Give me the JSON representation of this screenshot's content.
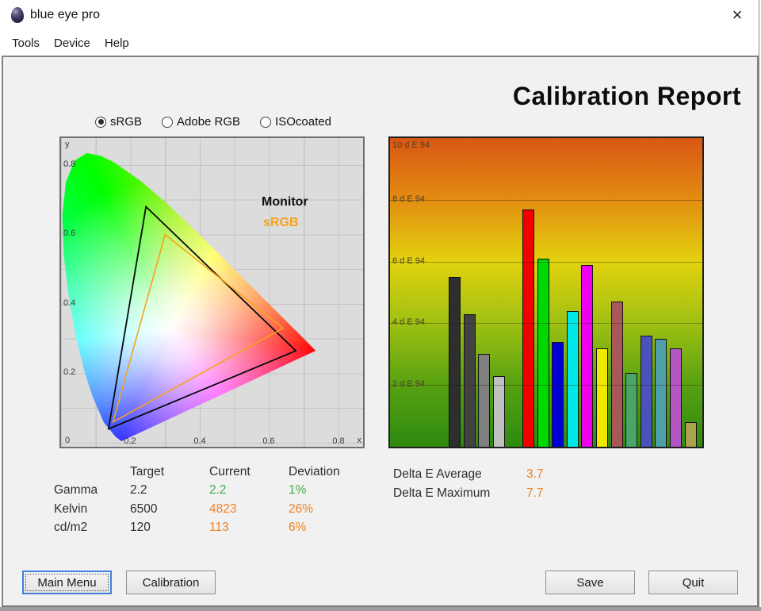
{
  "window": {
    "title": "blue eye pro",
    "close_glyph": "×"
  },
  "menu": {
    "items": [
      "Tools",
      "Device",
      "Help"
    ]
  },
  "report_title": "Calibration Report",
  "gamut_selector": {
    "options": [
      {
        "label": "sRGB",
        "selected": true
      },
      {
        "label": "Adobe RGB",
        "selected": false
      },
      {
        "label": "ISOcoated",
        "selected": false
      }
    ]
  },
  "cie_chart": {
    "y_axis_label": "y",
    "x_axis_label": "x",
    "origin_label": "0",
    "y_ticks": [
      "0.8",
      "0.6",
      "0.4",
      "0.2"
    ],
    "x_ticks": [
      "0.2",
      "0.4",
      "0.6",
      "0.8"
    ],
    "legend": {
      "monitor": "Monitor",
      "reference": "sRGB",
      "reference_color": "#f5a21c"
    },
    "monitor_gamut": {
      "red": [
        0.677,
        0.265
      ],
      "green": [
        0.245,
        0.68
      ],
      "blue": [
        0.137,
        0.04
      ]
    },
    "srgb_gamut": {
      "red": [
        0.64,
        0.33
      ],
      "green": [
        0.3,
        0.6
      ],
      "blue": [
        0.15,
        0.06
      ]
    },
    "monitor_color": "#0a0a0a"
  },
  "delta_chart": {
    "ymax": 10,
    "axis_labels": [
      "10 d E 94",
      "8 d E 94",
      "6 d E 94",
      "4 d E 94",
      "2 d E 94"
    ],
    "gridline_values": [
      8,
      6,
      4,
      2
    ],
    "groups": [
      {
        "name": "grayscale",
        "bars": [
          {
            "name": "black",
            "value": 5.5,
            "color": "#2e2e2e"
          },
          {
            "name": "dark-gray",
            "value": 4.3,
            "color": "#424242"
          },
          {
            "name": "gray",
            "value": 3.0,
            "color": "#7f7f7f"
          },
          {
            "name": "light-gray",
            "value": 2.3,
            "color": "#c0c0c0"
          }
        ]
      },
      {
        "name": "colors",
        "bars": [
          {
            "name": "red",
            "value": 7.7,
            "color": "#f20000"
          },
          {
            "name": "green",
            "value": 6.1,
            "color": "#00d900"
          },
          {
            "name": "blue",
            "value": 3.4,
            "color": "#0000d6"
          },
          {
            "name": "cyan",
            "value": 4.4,
            "color": "#00e8e8"
          },
          {
            "name": "magenta",
            "value": 5.9,
            "color": "#ef00ef"
          },
          {
            "name": "yellow",
            "value": 3.2,
            "color": "#f0ea00"
          },
          {
            "name": "brown",
            "value": 4.7,
            "color": "#a85858"
          },
          {
            "name": "sea-green",
            "value": 2.4,
            "color": "#4aa567"
          },
          {
            "name": "slate-blue",
            "value": 3.6,
            "color": "#4b52bd"
          },
          {
            "name": "teal",
            "value": 3.5,
            "color": "#4f9fab"
          },
          {
            "name": "orchid",
            "value": 3.2,
            "color": "#b356c1"
          },
          {
            "name": "khaki",
            "value": 0.8,
            "color": "#aba24e"
          }
        ]
      }
    ]
  },
  "results_table": {
    "headers": [
      "Target",
      "Current",
      "Deviation"
    ],
    "rows": [
      {
        "label": "Gamma",
        "target": "2.2",
        "current": "2.2",
        "deviation": "1%",
        "status": "good"
      },
      {
        "label": "Kelvin",
        "target": "6500",
        "current": "4823",
        "deviation": "26%",
        "status": "off"
      },
      {
        "label": "cd/m2",
        "target": "120",
        "current": "113",
        "deviation": "6%",
        "status": "off"
      }
    ]
  },
  "delta_summary": {
    "average_label": "Delta E Average",
    "average_value": "3.7",
    "maximum_label": "Delta E Maximum",
    "maximum_value": "7.7"
  },
  "action_buttons": {
    "main_menu": "Main Menu",
    "calibration": "Calibration",
    "save": "Save",
    "quit": "Quit"
  },
  "chart_data": [
    {
      "type": "area",
      "title": "CIE 1931 xy chromaticity diagram with gamut triangles",
      "xlabel": "x",
      "ylabel": "y",
      "xlim": [
        0,
        0.875
      ],
      "ylim": [
        0,
        0.88
      ],
      "grid": true,
      "series": [
        {
          "name": "Monitor",
          "points": [
            [
              0.245,
              0.68
            ],
            [
              0.677,
              0.265
            ],
            [
              0.137,
              0.04
            ]
          ],
          "color": "#000000"
        },
        {
          "name": "sRGB",
          "points": [
            [
              0.3,
              0.6
            ],
            [
              0.64,
              0.33
            ],
            [
              0.15,
              0.06
            ]
          ],
          "color": "#f5a21c"
        }
      ]
    },
    {
      "type": "bar",
      "title": "Delta E 94 per test patch",
      "categories": [
        "black",
        "dark-gray",
        "gray",
        "light-gray",
        "red",
        "green",
        "blue",
        "cyan",
        "magenta",
        "yellow",
        "brown",
        "sea-green",
        "slate-blue",
        "teal",
        "orchid",
        "khaki"
      ],
      "values": [
        5.5,
        4.3,
        3.0,
        2.3,
        7.7,
        6.1,
        3.4,
        4.4,
        5.9,
        3.2,
        4.7,
        2.4,
        3.6,
        3.5,
        3.2,
        0.8
      ],
      "ylabel": "d E 94",
      "ylim": [
        0,
        10
      ],
      "gridlines": [
        2,
        4,
        6,
        8,
        10
      ],
      "annotations": {
        "average": 3.7,
        "maximum": 7.7
      }
    }
  ]
}
